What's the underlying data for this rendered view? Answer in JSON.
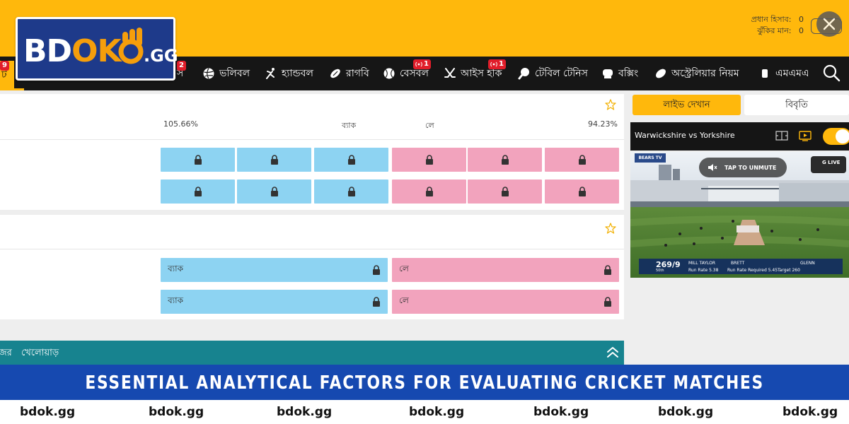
{
  "logo": {
    "brand_white": "BD",
    "brand_orange": "OK",
    "tld": ".GG"
  },
  "account": {
    "main_balance_label": "প্রধান হিসাব:",
    "main_balance_value": "0",
    "exposure_label": "ঝুঁকির মান:",
    "exposure_value": "0"
  },
  "nav": {
    "active_fragment": "ট",
    "active_badge": "9",
    "badge_left": "2",
    "items": [
      {
        "label": "ভলিবল",
        "icon": "volleyball-icon"
      },
      {
        "label": "হ্যান্ডবল",
        "icon": "handball-icon"
      },
      {
        "label": "রাগবি",
        "icon": "rugby-icon"
      },
      {
        "label": "বেসবল",
        "icon": "baseball-icon",
        "badge": "1"
      },
      {
        "label": "আইস হকি",
        "icon": "ice-hockey-icon",
        "badge": "1"
      },
      {
        "label": "টেবিল টেনিস",
        "icon": "table-tennis-icon"
      },
      {
        "label": "বক্সিং",
        "icon": "boxing-icon"
      },
      {
        "label": "অস্ট্রেলিয়ার নিয়ম",
        "icon": "aussie-rules-icon"
      },
      {
        "label": "এমএমএ",
        "icon": "mma-icon"
      }
    ],
    "partial_left": "স"
  },
  "market1": {
    "min_percent": "105.66%",
    "back_label": "ব্যাক",
    "lay_label": "লে",
    "max_percent": "94.23%"
  },
  "market2": {
    "back_label": "ব্যাক",
    "lay_label": "লে"
  },
  "players_bar": {
    "left_fragment": "জর",
    "label": "খেলোয়াড়"
  },
  "side": {
    "live_button": "লাইভ দেখান",
    "stats_button": "বিবৃতি",
    "match_title": "Warwickshire vs Yorkshire",
    "unmute_text": "TAP TO UNMUTE",
    "glive_text": "G LIVE",
    "channel_text": "BEARS TV",
    "score": "269/9",
    "overs": "50th",
    "batter1": "MILL TAYLOR",
    "batter2": "BRETT",
    "bowler": "GLENN",
    "run_rate": "Run Rate 5.38",
    "req_rate": "Run Rate Required 5.45",
    "target": "Target 260"
  },
  "banner": {
    "title": "ESSENTIAL ANALYTICAL FACTORS FOR EVALUATING CRICKET MATCHES"
  },
  "footer": {
    "domain": "bdok.gg"
  },
  "colors": {
    "brand_yellow": "#ffb80c",
    "brand_blue": "#1649b0",
    "back": "#8dd3f2",
    "lay": "#f2a3bd",
    "teal": "#17838f"
  }
}
